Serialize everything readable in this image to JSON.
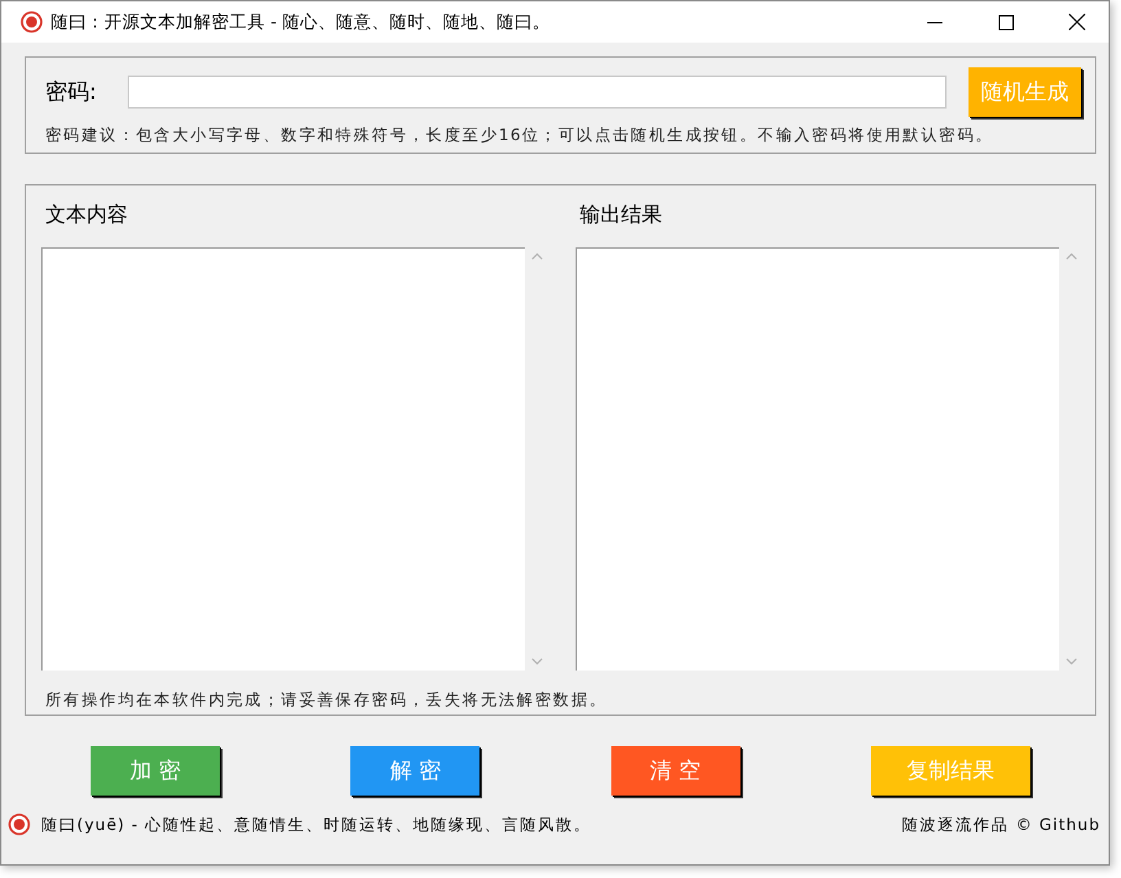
{
  "window": {
    "title": "随曰：开源文本加解密工具 - 随心、随意、随时、随地、随曰。"
  },
  "password": {
    "label": "密码:",
    "button": "随机生成",
    "hint": "密码建议：包含大小写字母、数字和特殊符号，长度至少16位；可以点击随机生成按钮。不输入密码将使用默认密码。"
  },
  "panels": [
    {
      "title": "文本内容"
    },
    {
      "title": "输出结果"
    }
  ],
  "note": "所有操作均在本软件内完成；请妥善保存密码，丢失将无法解密数据。",
  "buttons": [
    {
      "label": "加 密",
      "color": "#4caf50"
    },
    {
      "label": "解 密",
      "color": "#2196f3"
    },
    {
      "label": "清 空",
      "color": "#ff5722"
    },
    {
      "label": "复制结果",
      "color": "#ffc107"
    }
  ],
  "status_bar": {
    "motto": "随曰(yuē) - 心随性起、意随情生、时随运转、地随缘现、言随风散。",
    "credit": "随波逐流作品 © Github"
  }
}
